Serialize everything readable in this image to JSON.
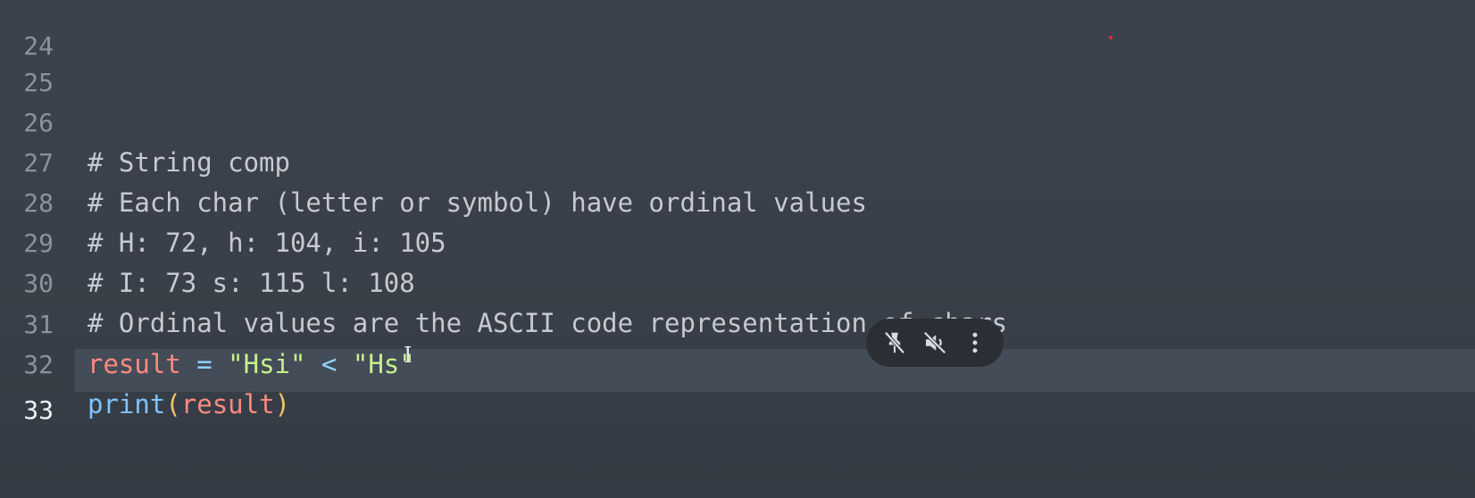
{
  "editor": {
    "lines": [
      {
        "number": "24",
        "text": ""
      },
      {
        "number": "25",
        "text": ""
      },
      {
        "number": "26",
        "comment": "# String comp"
      },
      {
        "number": "27",
        "comment": "# Each char (letter or symbol) have ordinal values"
      },
      {
        "number": "28",
        "comment": "# H: 72, h: 104, i: 105"
      },
      {
        "number": "29",
        "comment": "# I: 73 s: 115 l: 108"
      },
      {
        "number": "30",
        "comment": "# Ordinal values are the ASCII code representation of chars"
      },
      {
        "number": "31",
        "tokens": {
          "var": "result",
          "eq": " = ",
          "str1": "\"Hsi\"",
          "lt": " < ",
          "str2": "\"Hs\""
        }
      },
      {
        "number": "32",
        "tokens": {
          "fn": "print",
          "open": "(",
          "arg": "result",
          "close": ")"
        }
      },
      {
        "number": "33",
        "text": "",
        "active": true
      }
    ]
  },
  "media_controls": {
    "icons": [
      "unpin-icon",
      "mute-icon",
      "more-vertical-icon"
    ]
  },
  "colors": {
    "background": "#3a414c",
    "comment": "#c5cad2",
    "variable": "#ff8a80",
    "string": "#c6f28c",
    "function": "#7fc3ff",
    "operator": "#8fd3ff",
    "paren": "#f3c26b"
  }
}
